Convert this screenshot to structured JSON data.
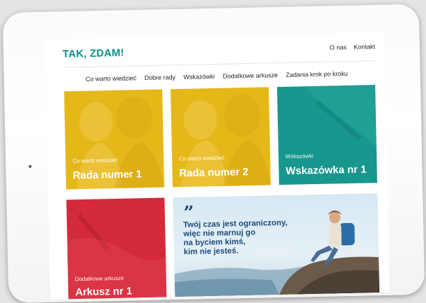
{
  "site": {
    "logo": "TAK, ZDAM!",
    "top_links": [
      "O nas",
      "Kontakt"
    ],
    "nav": [
      "Co warto wiedzieć",
      "Dobre rady",
      "Wskazówki",
      "Dodatkowe arkusze",
      "Zadania krok po kroku"
    ]
  },
  "tiles": [
    {
      "category": "Co warto wiedzieć",
      "title": "Rada numer 1"
    },
    {
      "category": "Co warto wiedzieć",
      "title": "Rada numer 2"
    },
    {
      "category": "Wskazówki",
      "title": "Wskazówka nr 1"
    },
    {
      "category": "Dodatkowe arkusze",
      "title": "Arkusz nr 1"
    }
  ],
  "quote": {
    "mark": "”",
    "lines": [
      "Twój czas jest ograniczony,",
      "więc nie marnuj go",
      "na byciem kimś,",
      "kim nie jesteś."
    ]
  },
  "colors": {
    "brand": "#0b8f86",
    "yellow": "#e5b81a",
    "teal": "#17978d",
    "red": "#d42a3a",
    "quote": "#1b4a7a"
  },
  "icons": [
    "home-button"
  ]
}
